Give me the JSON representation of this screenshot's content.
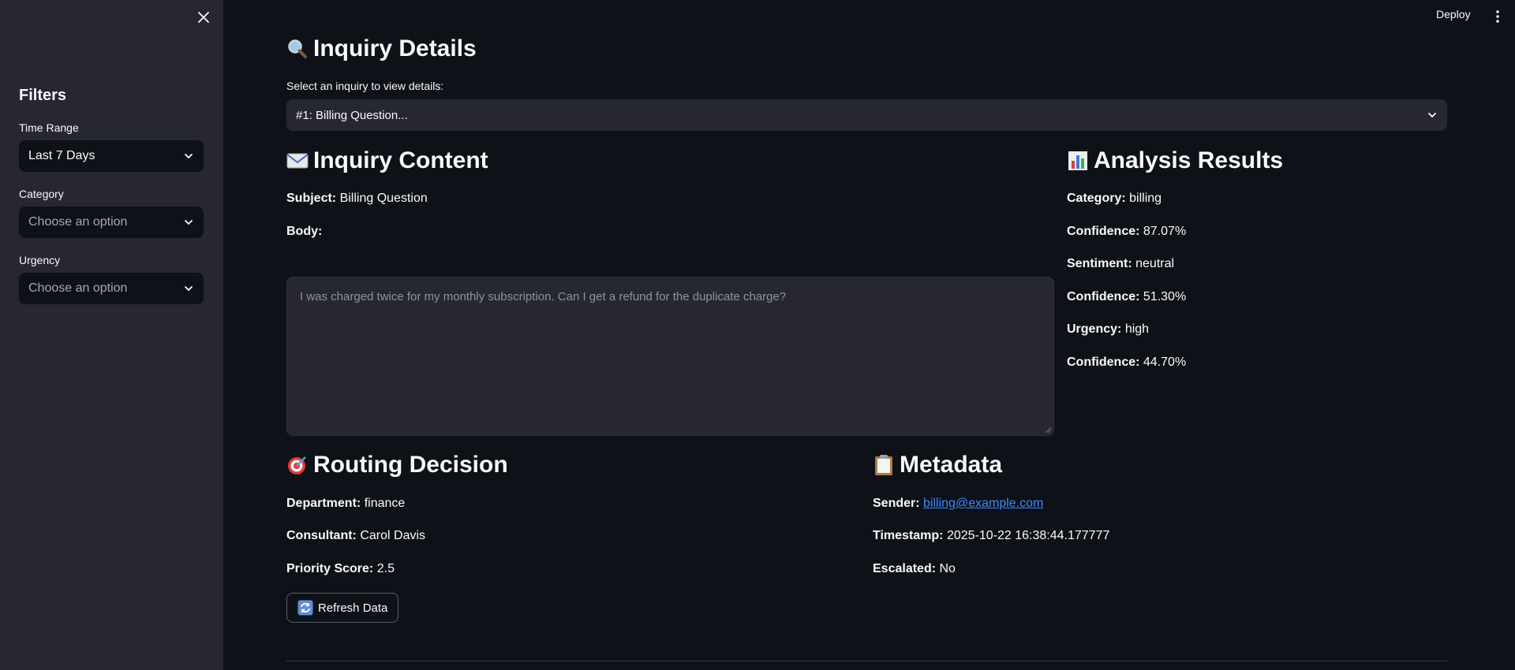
{
  "toolbar": {
    "deploy_label": "Deploy"
  },
  "sidebar": {
    "title": "Filters",
    "time_range": {
      "label": "Time Range",
      "value": "Last 7 Days"
    },
    "category": {
      "label": "Category",
      "placeholder": "Choose an option"
    },
    "urgency": {
      "label": "Urgency",
      "placeholder": "Choose an option"
    }
  },
  "page": {
    "title": "Inquiry Details",
    "title_icon": "magnifier-icon",
    "select_label": "Select an inquiry to view details:",
    "selected_inquiry": "#1: Billing Question..."
  },
  "inquiry": {
    "heading": "Inquiry Content",
    "icon": "envelope-icon",
    "subject_label": "Subject:",
    "subject": "Billing Question",
    "body_label": "Body:",
    "body": "I was charged twice for my monthly subscription. Can I get a refund for the duplicate charge?"
  },
  "analysis": {
    "heading": "Analysis Results",
    "icon": "bar-chart-icon",
    "category_label": "Category:",
    "category": "billing",
    "confidence_label": "Confidence:",
    "category_confidence": "87.07%",
    "sentiment_label": "Sentiment:",
    "sentiment": "neutral",
    "sentiment_confidence": "51.30%",
    "urgency_label": "Urgency:",
    "urgency": "high",
    "urgency_confidence": "44.70%"
  },
  "routing": {
    "heading": "Routing Decision",
    "icon": "target-icon",
    "department_label": "Department:",
    "department": "finance",
    "consultant_label": "Consultant:",
    "consultant": "Carol Davis",
    "priority_label": "Priority Score:",
    "priority": "2.5"
  },
  "metadata": {
    "heading": "Metadata",
    "icon": "clipboard-icon",
    "sender_label": "Sender:",
    "sender": "billing@example.com",
    "timestamp_label": "Timestamp:",
    "timestamp": "2025-10-22 16:38:44.177777",
    "escalated_label": "Escalated:",
    "escalated": "No"
  },
  "actions": {
    "refresh_label": "Refresh Data",
    "refresh_icon": "refresh-icon"
  },
  "colors": {
    "bg": "#0e1117",
    "sidebar": "#262730",
    "link": "#3b8bff"
  }
}
